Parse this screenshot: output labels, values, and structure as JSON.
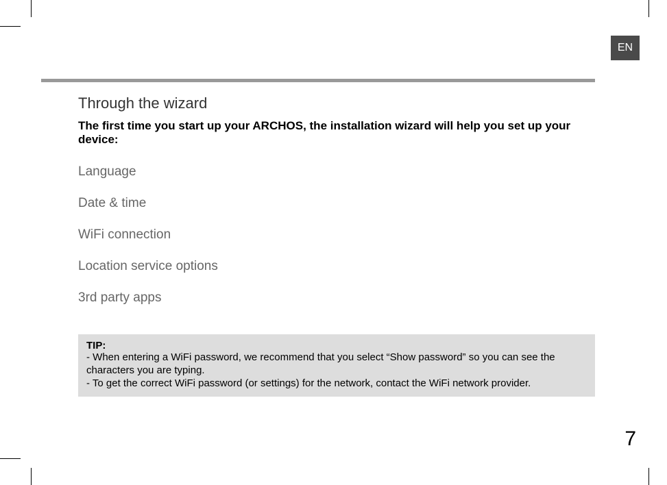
{
  "lang_tab": "EN",
  "section": {
    "title": "Through the wizard",
    "intro": "The first time you start up your ARCHOS, the installation wizard will help you set up your device:",
    "items": [
      "Language",
      "Date & time",
      " WiFi connection",
      "Location service options",
      "3rd party apps"
    ]
  },
  "tip": {
    "heading": "TIP:",
    "line1": "-    When entering a WiFi password, we recommend that you select “Show password” so you can see the characters you are typing.",
    "line2": "-   To get the correct WiFi password (or settings) for the network, contact the WiFi network provider."
  },
  "page_number": "7"
}
